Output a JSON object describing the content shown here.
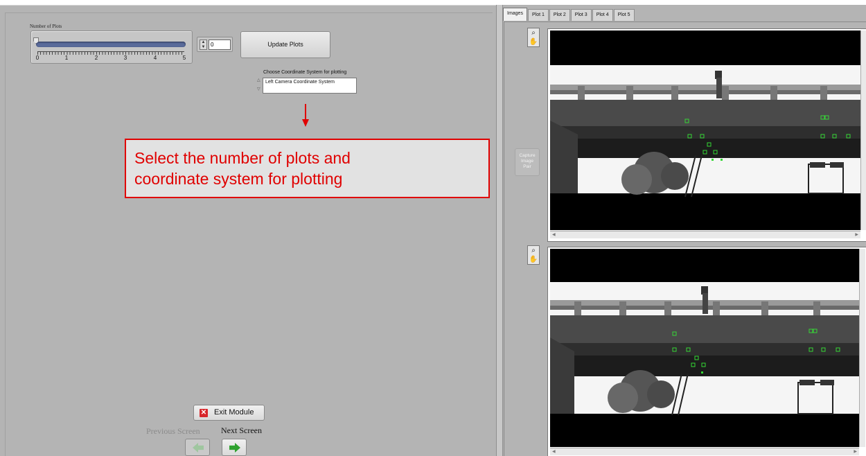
{
  "left": {
    "slider": {
      "label": "Number of Plots",
      "ticks": [
        "0",
        "1",
        "2",
        "3",
        "4",
        "5"
      ],
      "value": 0,
      "max": 5
    },
    "numeric": {
      "value": "0"
    },
    "update_button": "Update Plots",
    "coordinate": {
      "label": "Choose Coordinate System for plotting",
      "selected": "Left Camera Coordinate System"
    },
    "callout": {
      "line1": "Select the number of plots and",
      "line2": "coordinate system for plotting"
    },
    "exit_button": "Exit Module",
    "previous_label": "Previous Screen",
    "next_label": "Next Screen"
  },
  "tabs": [
    "Images",
    "Plot 1",
    "Plot 2",
    "Plot 3",
    "Plot 4",
    "Plot 5"
  ],
  "active_tab": "Images",
  "capture_button": {
    "line1": "Capture",
    "line2": "Image",
    "line3": "Pair"
  },
  "icons": {
    "zoom": "magnifier-icon",
    "pan": "hand-icon",
    "exit": "close-x-icon",
    "prev": "left-arrow-icon",
    "next": "right-arrow-icon"
  },
  "colors": {
    "panel_bg": "#b4b4b4",
    "callout_red": "#e00000",
    "marker_green": "#35d735",
    "slider_fill": "#5a6b9a"
  }
}
